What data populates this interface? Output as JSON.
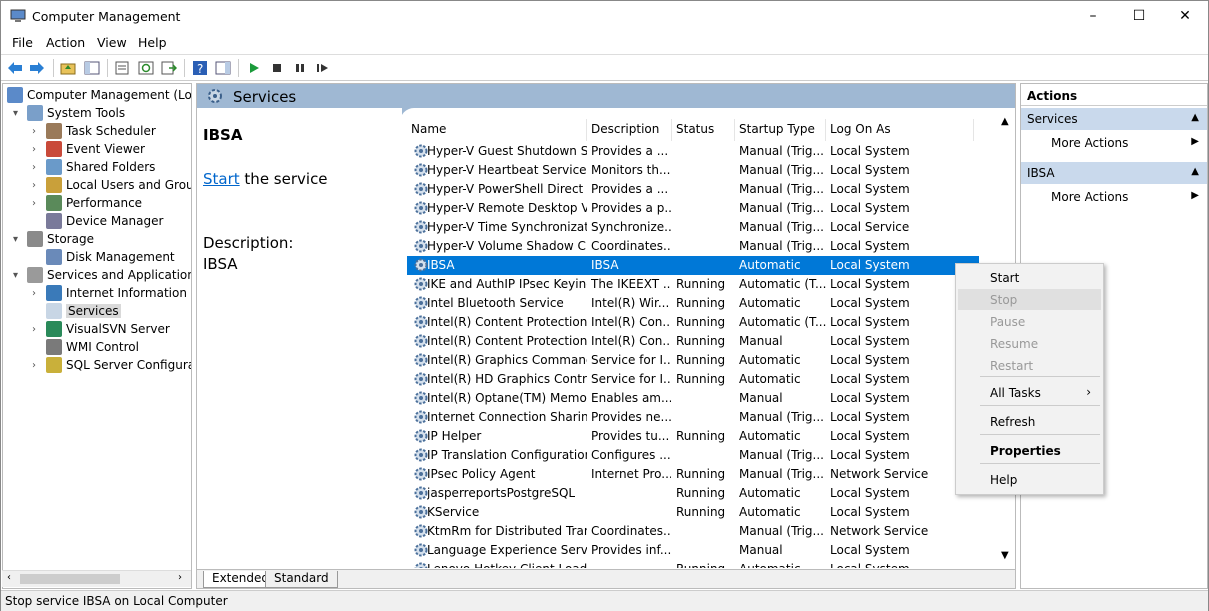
{
  "window": {
    "title": "Computer Management",
    "minimize": "–",
    "maximize": "☐",
    "close": "✕"
  },
  "menu": [
    "File",
    "Action",
    "View",
    "Help"
  ],
  "tree": [
    {
      "label": "Computer Management (Local",
      "expander": "",
      "depth": 0
    },
    {
      "label": "System Tools",
      "expander": "▾",
      "depth": 1
    },
    {
      "label": "Task Scheduler",
      "expander": "›",
      "depth": 2
    },
    {
      "label": "Event Viewer",
      "expander": "›",
      "depth": 2
    },
    {
      "label": "Shared Folders",
      "expander": "›",
      "depth": 2
    },
    {
      "label": "Local Users and Groups",
      "expander": "›",
      "depth": 2
    },
    {
      "label": "Performance",
      "expander": "›",
      "depth": 2
    },
    {
      "label": "Device Manager",
      "expander": "",
      "depth": 2
    },
    {
      "label": "Storage",
      "expander": "▾",
      "depth": 1
    },
    {
      "label": "Disk Management",
      "expander": "",
      "depth": 2
    },
    {
      "label": "Services and Applications",
      "expander": "▾",
      "depth": 1
    },
    {
      "label": "Internet Information Ser",
      "expander": "›",
      "depth": 2
    },
    {
      "label": "Services",
      "expander": "",
      "depth": 2,
      "selected": true
    },
    {
      "label": "VisualSVN Server",
      "expander": "›",
      "depth": 2
    },
    {
      "label": "WMI Control",
      "expander": "",
      "depth": 2
    },
    {
      "label": "SQL Server Configuratic",
      "expander": "›",
      "depth": 2
    }
  ],
  "center": {
    "title": "Services",
    "selected_service": "IBSA",
    "start_link": "Start",
    "start_rest": " the service",
    "desc_label": "Description:",
    "desc_value": "IBSA",
    "columns": [
      "Name",
      "Description",
      "Status",
      "Startup Type",
      "Log On As"
    ],
    "sort_indicator": "^",
    "rows": [
      [
        "Hyper-V Guest Shutdown S...",
        "Provides a ...",
        "",
        "Manual (Trig...",
        "Local System"
      ],
      [
        "Hyper-V Heartbeat Service",
        "Monitors th...",
        "",
        "Manual (Trig...",
        "Local System"
      ],
      [
        "Hyper-V PowerShell Direct ...",
        "Provides a ...",
        "",
        "Manual (Trig...",
        "Local System"
      ],
      [
        "Hyper-V Remote Desktop Vi...",
        "Provides a p...",
        "",
        "Manual (Trig...",
        "Local System"
      ],
      [
        "Hyper-V Time Synchronizati...",
        "Synchronize...",
        "",
        "Manual (Trig...",
        "Local Service"
      ],
      [
        "Hyper-V Volume Shadow C...",
        "Coordinates...",
        "",
        "Manual (Trig...",
        "Local System"
      ],
      [
        "IBSA",
        "IBSA",
        "",
        "Automatic",
        "Local System"
      ],
      [
        "IKE and AuthIP IPsec Keying...",
        "The IKEEXT ...",
        "Running",
        "Automatic (T...",
        "Local System"
      ],
      [
        "Intel Bluetooth Service",
        "Intel(R) Wir...",
        "Running",
        "Automatic",
        "Local System"
      ],
      [
        "Intel(R) Content Protection ...",
        "Intel(R) Con...",
        "Running",
        "Automatic (T...",
        "Local System"
      ],
      [
        "Intel(R) Content Protection ...",
        "Intel(R) Con...",
        "Running",
        "Manual",
        "Local System"
      ],
      [
        "Intel(R) Graphics Command...",
        "Service for I...",
        "Running",
        "Automatic",
        "Local System"
      ],
      [
        "Intel(R) HD Graphics Contro...",
        "Service for I...",
        "Running",
        "Automatic",
        "Local System"
      ],
      [
        "Intel(R) Optane(TM) Memor...",
        "Enables am...",
        "",
        "Manual",
        "Local System"
      ],
      [
        "Internet Connection Sharin...",
        "Provides ne...",
        "",
        "Manual (Trig...",
        "Local System"
      ],
      [
        "IP Helper",
        "Provides tu...",
        "Running",
        "Automatic",
        "Local System"
      ],
      [
        "IP Translation Configuration...",
        "Configures ...",
        "",
        "Manual (Trig...",
        "Local System"
      ],
      [
        "IPsec Policy Agent",
        "Internet Pro...",
        "Running",
        "Manual (Trig...",
        "Network Service"
      ],
      [
        "jasperreportsPostgreSQL",
        "",
        "Running",
        "Automatic",
        "Local System"
      ],
      [
        "KService",
        "",
        "Running",
        "Automatic",
        "Local System"
      ],
      [
        "KtmRm for Distributed Tran...",
        "Coordinates...",
        "",
        "Manual (Trig...",
        "Network Service"
      ],
      [
        "Language Experience Service",
        "Provides inf...",
        "",
        "Manual",
        "Local System"
      ],
      [
        "Lenovo Hotkey Client Loader",
        "",
        "Running",
        "Automatic",
        "Local System"
      ]
    ],
    "tabs": [
      "Extended",
      "Standard"
    ]
  },
  "actions": {
    "header": "Actions",
    "groups": [
      {
        "title": "Services",
        "item": "More Actions"
      },
      {
        "title": "IBSA",
        "item": "More Actions"
      }
    ]
  },
  "context_menu": [
    {
      "label": "Start",
      "state": "enabled"
    },
    {
      "label": "Stop",
      "state": "disabled",
      "highlight": true
    },
    {
      "label": "Pause",
      "state": "disabled"
    },
    {
      "label": "Resume",
      "state": "disabled"
    },
    {
      "label": "Restart",
      "state": "disabled"
    },
    {
      "label": "All Tasks",
      "state": "enabled",
      "submenu": true
    },
    {
      "label": "Refresh",
      "state": "enabled"
    },
    {
      "label": "Properties",
      "state": "bold"
    },
    {
      "label": "Help",
      "state": "enabled"
    }
  ],
  "status": "Stop service IBSA on Local Computer",
  "colors": {
    "selection": "#0078d7",
    "header_band": "#9fb8d3",
    "action_group": "#c9d9ec",
    "link": "#0066cc"
  }
}
